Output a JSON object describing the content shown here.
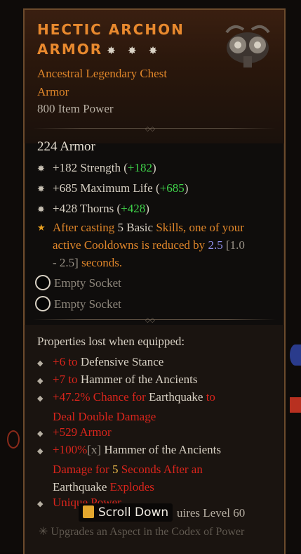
{
  "item": {
    "title_line1": "HECTIC ARCHON",
    "title_line2": "ARMOR",
    "stars": "✸ ✸ ✸",
    "type_line1": "Ancestral Legendary Chest",
    "type_line2": "Armor",
    "item_power": "800 Item Power",
    "armor": "224 Armor"
  },
  "affixes": [
    {
      "text": "+182 Strength (",
      "bonus": "+182",
      "close": ")"
    },
    {
      "text": "+685 Maximum Life (",
      "bonus": "+685",
      "close": ")"
    },
    {
      "text": "+428 Thorns (",
      "bonus": "+428",
      "close": ")"
    }
  ],
  "legendary": {
    "p1": "After casting ",
    "n1": "5",
    "p2": " Basic",
    "p3": " Skills, one of your",
    "p4": "active Cooldowns is reduced by ",
    "n2": "2.5",
    "range1": " [1.0",
    "range2": "- 2.5]",
    "p5": " seconds."
  },
  "sockets": [
    "Empty Socket",
    "Empty Socket"
  ],
  "lost": {
    "title": "Properties lost when equipped:",
    "l1a": "+6 to ",
    "l1b": "Defensive Stance",
    "l2a": "+7 to ",
    "l2b": "Hammer of the Ancients",
    "l3a": "+47.2% Chance for ",
    "l3b": "Earthquake",
    "l3c": " to",
    "l3d": "Deal Double Damage",
    "l4": "+529 Armor",
    "l5a": "+100%",
    "l5b": "[x]",
    "l5c": " Hammer of the Ancients",
    "l5d": "Damage for ",
    "l5e": "5",
    "l5f": " Seconds After an",
    "l5g": "Earthquake",
    "l5h": " Explodes",
    "l6": "Unique Power"
  },
  "footer": {
    "scroll": "Scroll Down",
    "requires": "uires Level 60",
    "upgrades": "Upgrades an Aspect in the Codex of Power"
  },
  "colors": {
    "legendary": "#e0862a",
    "bonus": "#3fd34a",
    "lost": "#d9251c",
    "frame": "#6b4a2c"
  }
}
